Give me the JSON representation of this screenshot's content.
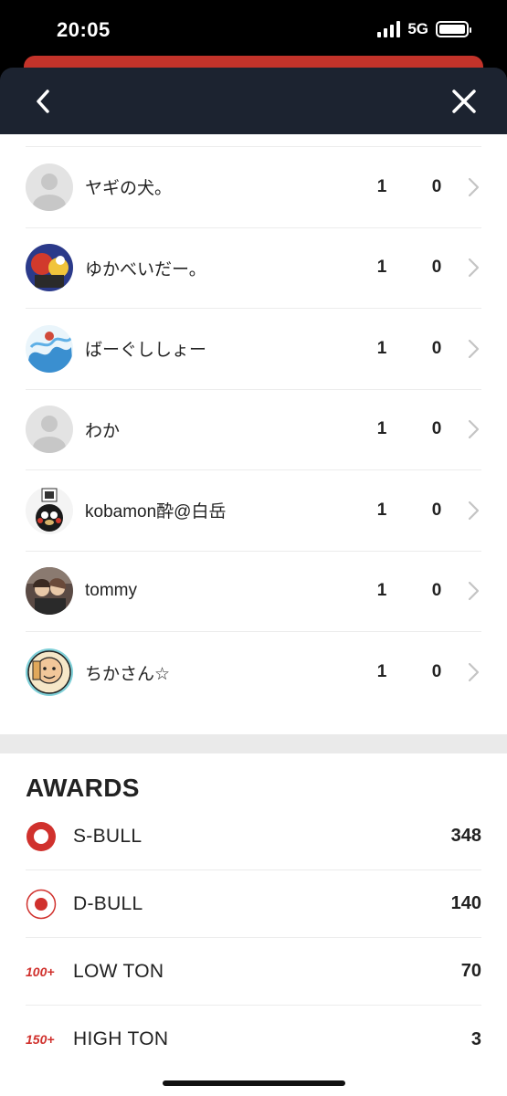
{
  "status_bar": {
    "time": "20:05",
    "network": "5G"
  },
  "players": [
    {
      "name": "ヤギの犬。",
      "col1": "1",
      "col2": "0",
      "avatar": "default-avatar-icon"
    },
    {
      "name": "ゆかべいだー。",
      "col1": "1",
      "col2": "0",
      "avatar": "photo-avatar"
    },
    {
      "name": "ばーぐししょー",
      "col1": "1",
      "col2": "0",
      "avatar": "photo-avatar"
    },
    {
      "name": "わか",
      "col1": "1",
      "col2": "0",
      "avatar": "default-avatar-icon"
    },
    {
      "name": "kobamon酔@白岳",
      "col1": "1",
      "col2": "0",
      "avatar": "photo-avatar"
    },
    {
      "name": "tommy",
      "col1": "1",
      "col2": "0",
      "avatar": "photo-avatar"
    },
    {
      "name": "ちかさん☆",
      "col1": "1",
      "col2": "0",
      "avatar": "photo-avatar"
    }
  ],
  "awards": {
    "title": "AWARDS",
    "items": [
      {
        "label": "S-BULL",
        "value": "348",
        "icon": "s-bull-icon"
      },
      {
        "label": "D-BULL",
        "value": "140",
        "icon": "d-bull-icon"
      },
      {
        "label": "LOW TON",
        "value": "70",
        "badge": "100+"
      },
      {
        "label": "HIGH TON",
        "value": "3",
        "badge": "150+"
      }
    ]
  },
  "colors": {
    "accent_red": "#d0312d",
    "header_bg": "#1c2330",
    "strip_red": "#c3332a"
  }
}
